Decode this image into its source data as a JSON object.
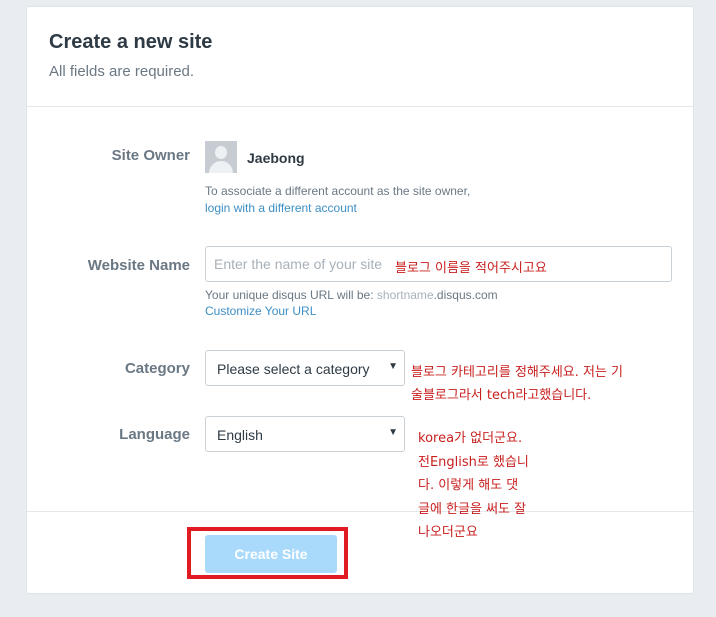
{
  "header": {
    "title": "Create a new site",
    "subtitle": "All fields are required."
  },
  "site_owner": {
    "label": "Site Owner",
    "name": "Jaebong",
    "hint": "To associate a different account as the site owner,",
    "link": "login with a different account"
  },
  "website_name": {
    "label": "Website Name",
    "placeholder": "Enter the name of your site",
    "value": "",
    "url_prefix": "Your unique disqus URL will be: ",
    "url_shortname": "shortname",
    "url_suffix": ".disqus.com",
    "customize_link": "Customize Your URL"
  },
  "category": {
    "label": "Category",
    "selected": "Please select a category"
  },
  "language": {
    "label": "Language",
    "selected": "English"
  },
  "create_button": {
    "label": "Create Site"
  },
  "annotations": {
    "name_note": "블로그 이름을 적어주시고요",
    "category_note_line1": "블로그 카테고리를 정해주세요. 저는 기",
    "category_note_line2": "술블로그라서 tech라고했습니다.",
    "language_note_lines": [
      "korea가 없더군요.",
      "전English로 했습니",
      "다. 이렇게 해도 댓",
      "글에 한글을 써도 잘",
      "나오더군요"
    ]
  },
  "colors": {
    "background": "#e9edf1",
    "link": "#3d8fc6",
    "button_disabled": "#a9dafc",
    "annotation_red": "#e11b22"
  },
  "icons": {
    "avatar": "default-user-avatar",
    "dropdown": "triangle-down"
  }
}
